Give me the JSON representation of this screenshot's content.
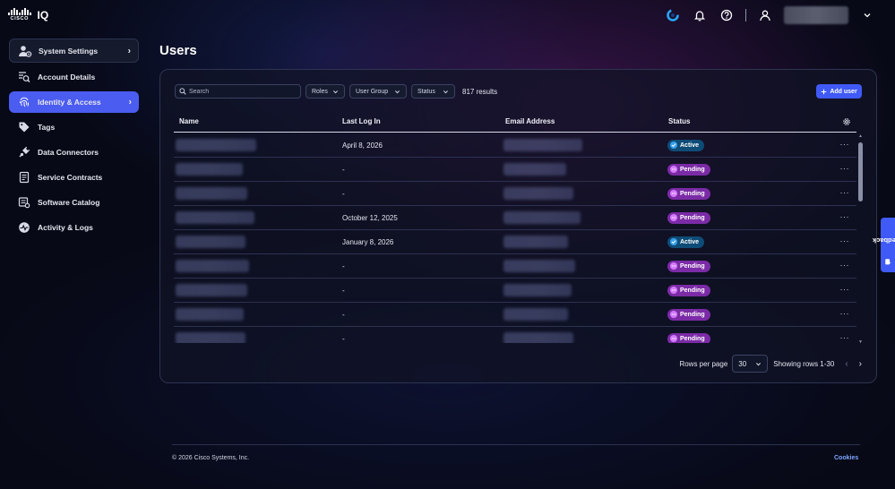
{
  "brand": {
    "wordmark": "CISCO",
    "product": "IQ"
  },
  "header": {
    "icons": [
      "brand-swirl-icon",
      "bell-icon",
      "help-icon",
      "user-icon",
      "chevron-down-icon"
    ],
    "colors": {
      "accent": "#3f5af6",
      "swirl": "#29a6ff"
    }
  },
  "sidebar": {
    "items": [
      {
        "label": "System Settings",
        "icon": "user-gear-icon",
        "chevron": true
      },
      {
        "label": "Account Details",
        "icon": "list-search-icon"
      },
      {
        "label": "Identity & Access",
        "icon": "fingerprint-icon",
        "chevron": true,
        "active": true
      },
      {
        "label": "Tags",
        "icon": "tag-icon"
      },
      {
        "label": "Data Connectors",
        "icon": "plug-icon"
      },
      {
        "label": "Service Contracts",
        "icon": "contract-icon"
      },
      {
        "label": "Software Catalog",
        "icon": "catalog-icon"
      },
      {
        "label": "Activity & Logs",
        "icon": "activity-icon"
      }
    ]
  },
  "page": {
    "title": "Users"
  },
  "toolbar": {
    "search_placeholder": "Search",
    "filters": [
      "Roles",
      "User Group",
      "Status"
    ],
    "results": "817 results",
    "add_label": "Add user"
  },
  "table": {
    "columns": [
      "Name",
      "Last Log In",
      "Email Address",
      "Status"
    ],
    "rows": [
      {
        "last_login": "April 8, 2026",
        "status": "Active"
      },
      {
        "last_login": "-",
        "status": "Pending"
      },
      {
        "last_login": "-",
        "status": "Pending"
      },
      {
        "last_login": "October 12, 2025",
        "status": "Pending"
      },
      {
        "last_login": "January 8, 2026",
        "status": "Active"
      },
      {
        "last_login": "-",
        "status": "Pending"
      },
      {
        "last_login": "-",
        "status": "Pending"
      },
      {
        "last_login": "-",
        "status": "Pending"
      },
      {
        "last_login": "-",
        "status": "Pending"
      }
    ],
    "more_glyph": "···"
  },
  "pagination": {
    "rows_per_page_label": "Rows per page",
    "rows_per_page_value": "30",
    "showing": "Showing rows 1-30"
  },
  "feedback": {
    "label": "Feedback"
  },
  "footer": {
    "copyright": "© 2026 Cisco Systems, Inc.",
    "cookies": "Cookies"
  }
}
